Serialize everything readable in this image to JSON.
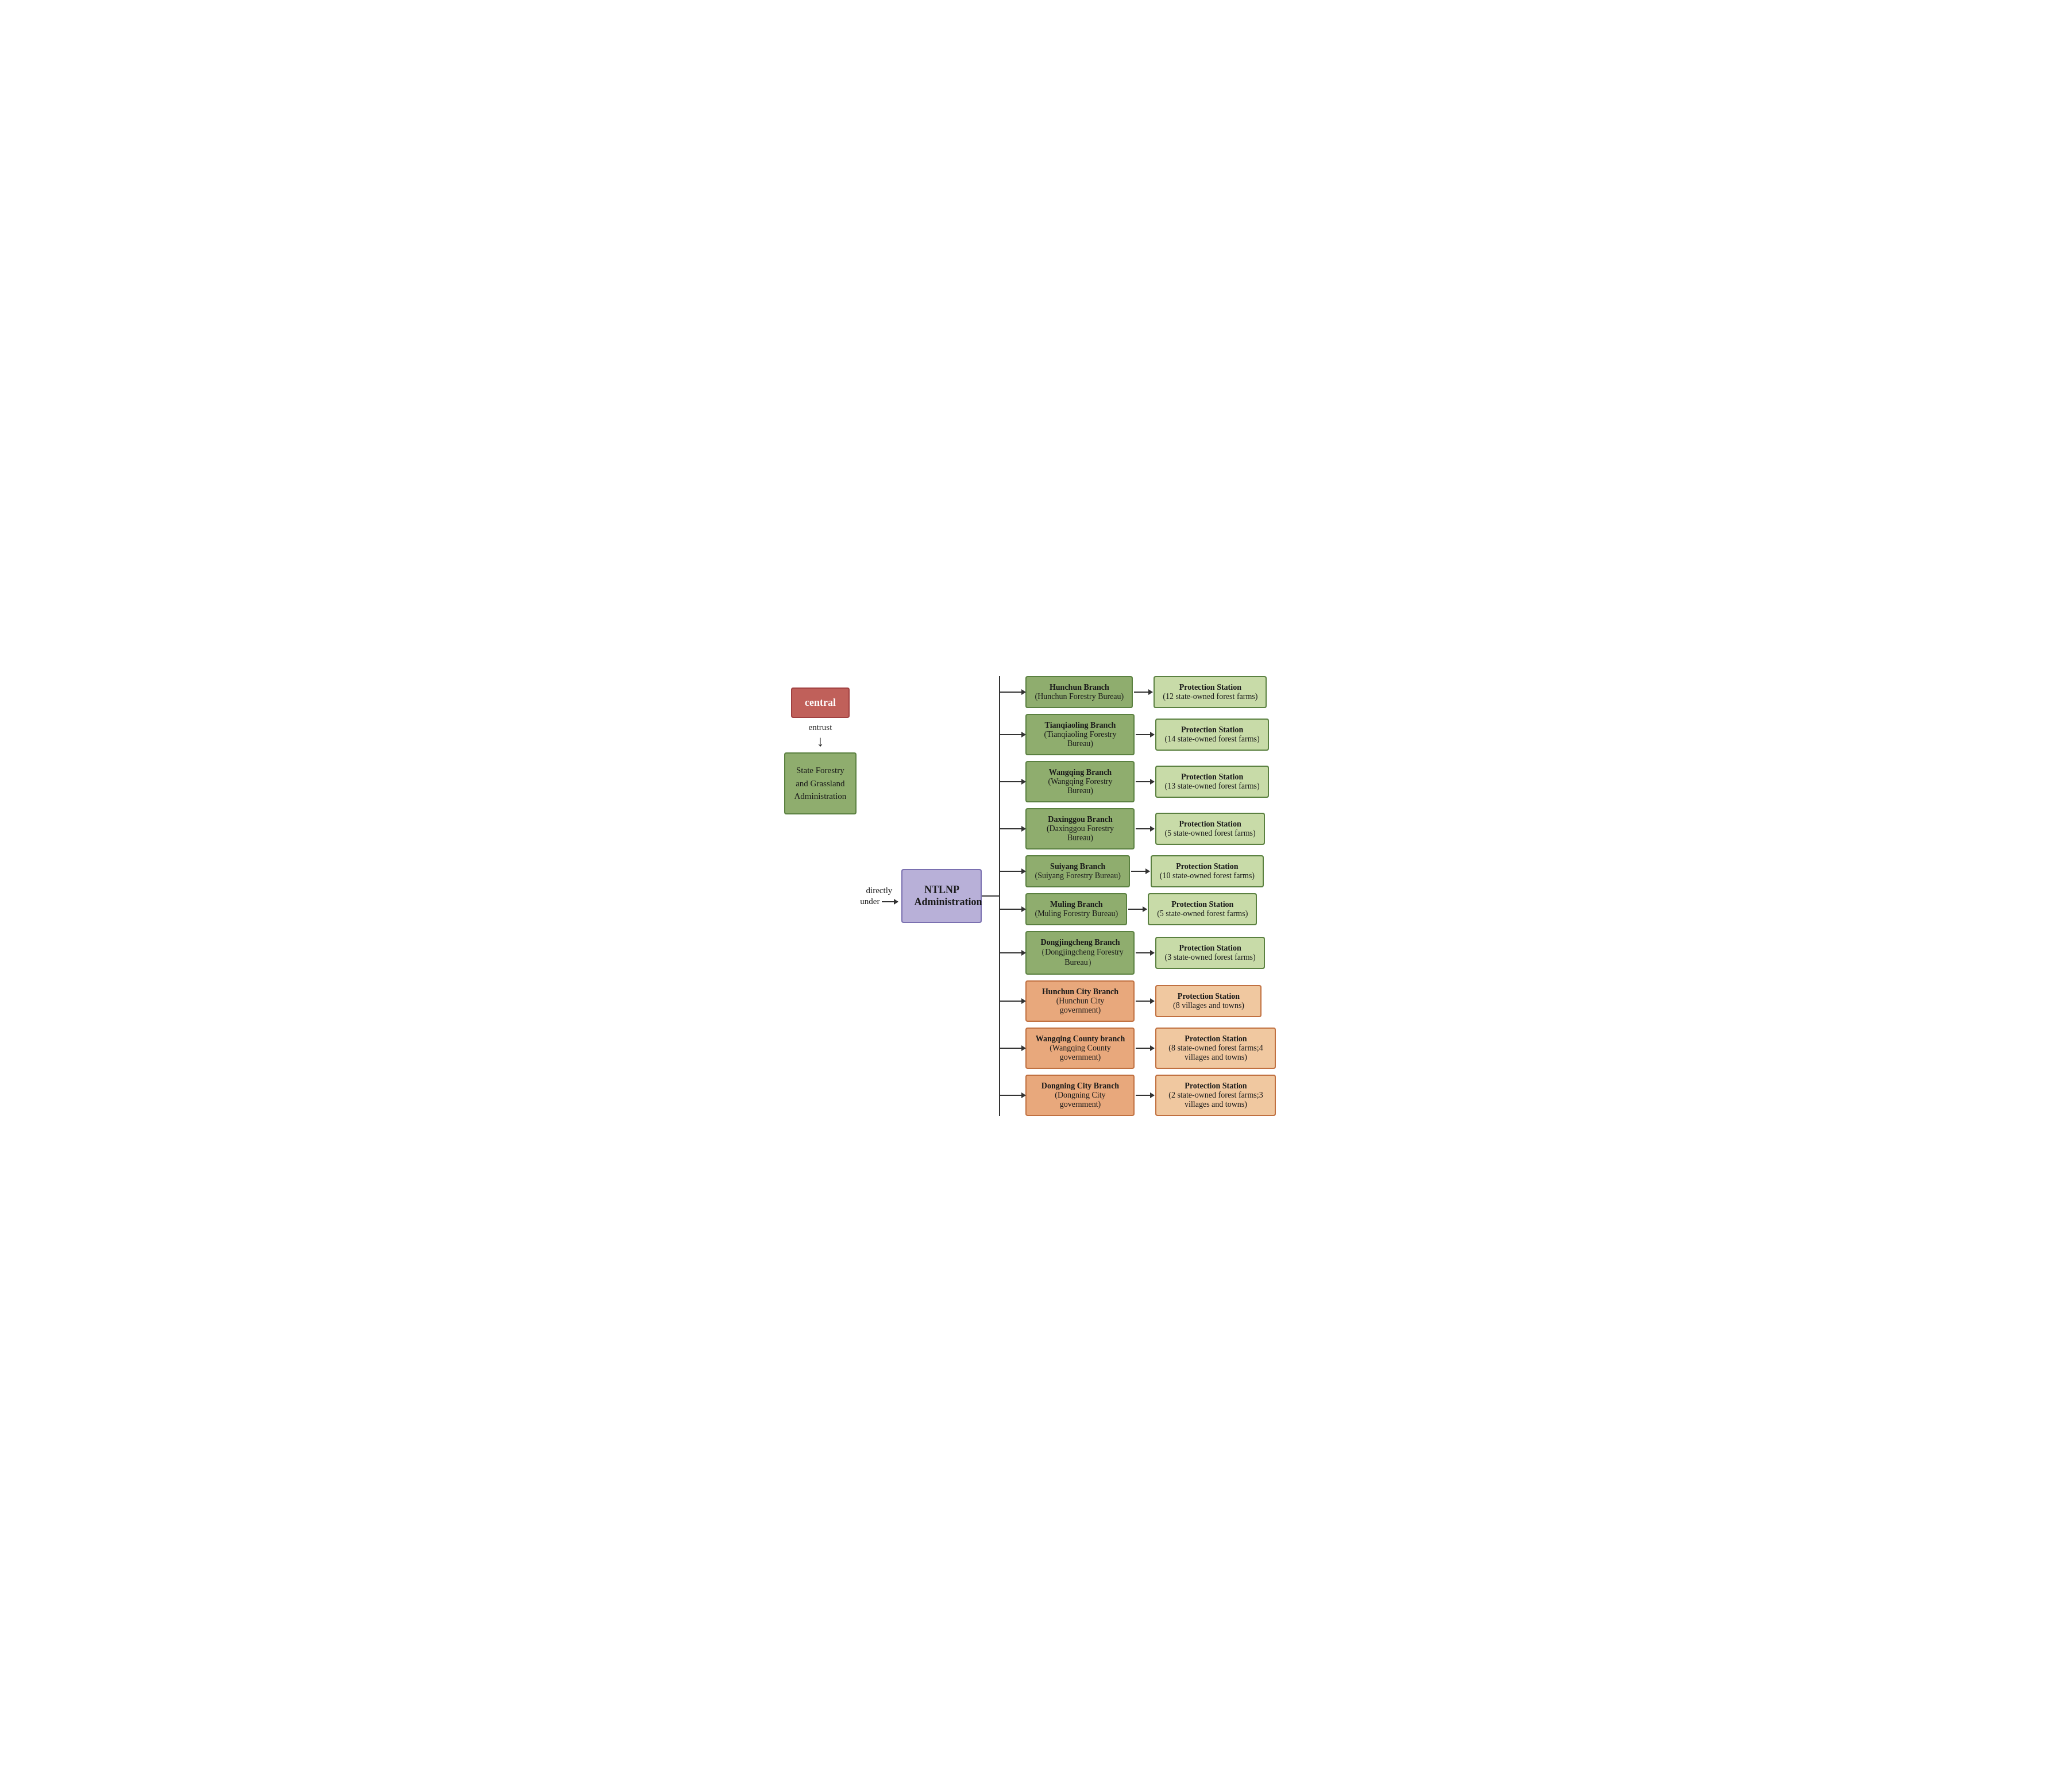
{
  "central": {
    "label": "central"
  },
  "entrust": {
    "label": "entrust",
    "arrow": "↓"
  },
  "stateForestry": {
    "line1": "State Forestry",
    "line2": "and Grassland",
    "line3": "Administration"
  },
  "directlyUnder": {
    "label": "directly\nunder",
    "arrow": "→"
  },
  "ntlnp": {
    "label": "NTLNP\nAdministration"
  },
  "branches": [
    {
      "name": "Hunchun Branch",
      "sub": "(Hunchun Forestry Bureau)",
      "type": "green",
      "protection": {
        "title": "Protection Station",
        "sub": "(12 state-owned forest farms)"
      }
    },
    {
      "name": "Tianqiaoling Branch",
      "sub": "(Tianqiaoling Forestry Bureau)",
      "type": "green",
      "protection": {
        "title": "Protection Station",
        "sub": "(14 state-owned forest farms)"
      }
    },
    {
      "name": "Wangqing Branch",
      "sub": "(Wangqing Forestry Bureau)",
      "type": "green",
      "protection": {
        "title": "Protection Station",
        "sub": "(13 state-owned forest farms)"
      }
    },
    {
      "name": "Daxinggou Branch",
      "sub": "(Daxinggou Forestry Bureau)",
      "type": "green",
      "protection": {
        "title": "Protection Station",
        "sub": "(5 state-owned forest farms)"
      }
    },
    {
      "name": "Suiyang Branch",
      "sub": "(Suiyang Forestry Bureau)",
      "type": "green",
      "protection": {
        "title": "Protection Station",
        "sub": "(10 state-owned forest farms)"
      }
    },
    {
      "name": "Muling Branch",
      "sub": "(Muling Forestry Bureau)",
      "type": "green",
      "protection": {
        "title": "Protection Station",
        "sub": "(5 state-owned forest farms)"
      }
    },
    {
      "name": "Dongjingcheng Branch",
      "sub": "（Dongjingcheng Forestry Bureau）",
      "type": "green",
      "protection": {
        "title": "Protection Station",
        "sub": "(3 state-owned forest farms)"
      }
    },
    {
      "name": "Hunchun City Branch",
      "sub": "(Hunchun City government)",
      "type": "orange",
      "protection": {
        "title": "Protection Station",
        "sub": "(8 villages and towns)"
      }
    },
    {
      "name": "Wangqing County branch",
      "sub": "(Wangqing County government)",
      "type": "orange",
      "protection": {
        "title": "Protection Station",
        "sub": "(8 state-owned forest farms;4 villages and towns)"
      }
    },
    {
      "name": "Dongning City Branch",
      "sub": "(Dongning City government)",
      "type": "orange",
      "protection": {
        "title": "Protection Station",
        "sub": "(2 state-owned forest farms;3 villages and towns)"
      }
    }
  ],
  "colors": {
    "central_bg": "#c0605a",
    "central_border": "#a04040",
    "state_bg": "#8fad6e",
    "state_border": "#5a8040",
    "ntlnp_bg": "#b8b0d8",
    "ntlnp_border": "#7a70b0",
    "branch_green_bg": "#8fad6e",
    "branch_green_border": "#5a8040",
    "branch_orange_bg": "#e8a87c",
    "branch_orange_border": "#c07040",
    "protection_green_bg": "#c8dba8",
    "protection_green_border": "#5a8040",
    "protection_orange_bg": "#f0c8a0",
    "protection_orange_border": "#c07040"
  }
}
